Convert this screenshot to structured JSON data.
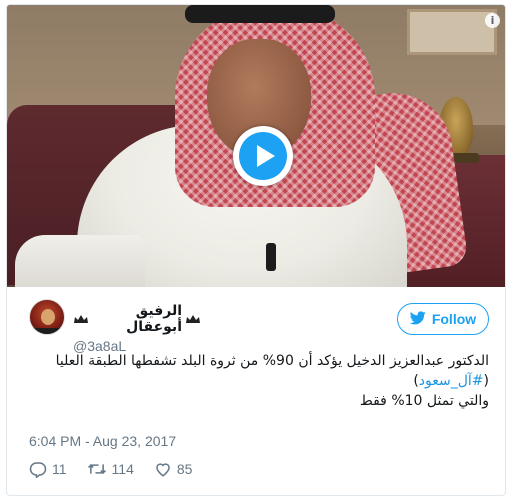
{
  "media": {
    "play_icon": "play-icon",
    "info_icon": "info-icon",
    "info_glyph": "i"
  },
  "user": {
    "display_name": "الرفيق أبوعقال",
    "handle": "@3a8aL",
    "avatar_icon": "avatar"
  },
  "follow": {
    "label": "Follow",
    "icon": "twitter-bird-icon",
    "color": "#1da1f2"
  },
  "tweet": {
    "text_line1_prefix": "الدكتور عبدالعزيز الدخيل يؤكد أن 90% من ثروة البلد تشفطها الطبقة العليا (",
    "hashtag": "#آل_سعود",
    "text_line1_suffix": ")",
    "text_line2": "والتي تمثل 10% فقط"
  },
  "timestamp": "6:04 PM - Aug 23, 2017",
  "actions": {
    "reply_count": "11",
    "retweet_count": "114",
    "like_count": "85"
  },
  "colors": {
    "link": "#1b95e0",
    "muted": "#657786",
    "text": "#14171a"
  }
}
